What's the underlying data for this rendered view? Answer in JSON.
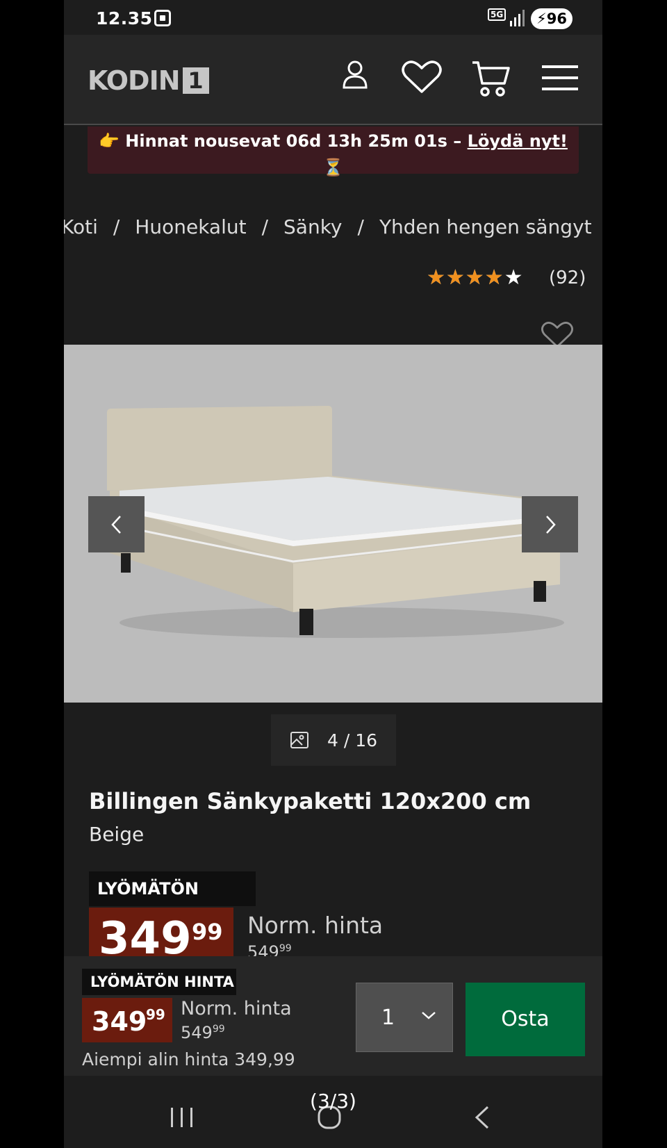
{
  "status": {
    "time": "12.35",
    "network": "5G",
    "battery": "96"
  },
  "header": {
    "logo_text": "KODIN",
    "logo_num": "1"
  },
  "promo": {
    "prefix": "👉 Hinnat nousevat 06d 13h 25m 01s – ",
    "link": "Löydä nyt!",
    "suffix": " ⏳"
  },
  "breadcrumb": [
    "Koti",
    "Huonekalut",
    "Sänky",
    "Yhden hengen sängyt"
  ],
  "rating": {
    "value": 3.5,
    "max": 5,
    "count": "(92)"
  },
  "gallery": {
    "counter": "4 / 16"
  },
  "product": {
    "title": "Billingen Sänkypaketti 120x200 cm",
    "variant": "Beige",
    "badge": "LYÖMÄTÖN HINTA",
    "price_main": "349",
    "price_dec": "99",
    "norm_label": "Norm. hinta",
    "norm_price": "549",
    "norm_dec": "99"
  },
  "sticky": {
    "badge": "LYÖMÄTÖN HINTA",
    "price_main": "349",
    "price_dec": "99",
    "norm_label": "Norm. hinta",
    "norm_price": "549",
    "norm_dec": "99",
    "lowest": "Aiempi alin hinta 349,99",
    "qty": "1",
    "buy_label": "Osta"
  },
  "pager": "(3/3)",
  "colors": {
    "accent_green": "#006b3c",
    "price_red": "#6b1c0e",
    "star_orange": "#f0901e",
    "promo_bg": "#3c1a20"
  }
}
